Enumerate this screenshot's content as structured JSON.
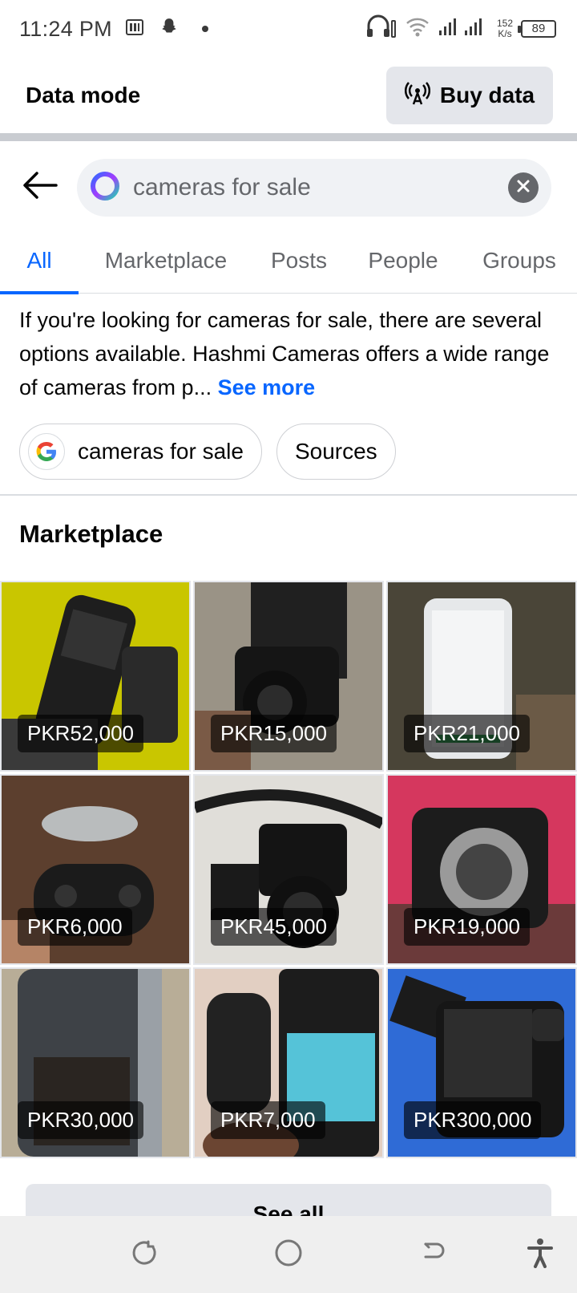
{
  "status_bar": {
    "time": "11:24 PM",
    "speed_value": "152",
    "speed_unit": "K/s",
    "battery": "89"
  },
  "data_bar": {
    "label": "Data mode",
    "buy_button": "Buy data"
  },
  "search": {
    "query": "cameras for sale"
  },
  "tabs": [
    {
      "label": "All",
      "active": true
    },
    {
      "label": "Marketplace",
      "active": false
    },
    {
      "label": "Posts",
      "active": false
    },
    {
      "label": "People",
      "active": false
    },
    {
      "label": "Groups",
      "active": false
    }
  ],
  "summary": {
    "text": "If you're looking for cameras for sale, there are several options available. Hashmi Cameras offers a wide range of cameras from p...",
    "see_more": "See more"
  },
  "chips": {
    "google": "cameras for sale",
    "sources": "Sources"
  },
  "marketplace": {
    "title": "Marketplace",
    "listings": [
      {
        "price": "PKR52,000",
        "icon": "camera-lens-icon"
      },
      {
        "price": "PKR15,000",
        "icon": "camera-icon"
      },
      {
        "price": "PKR21,000",
        "icon": "phone-icon"
      },
      {
        "price": "PKR6,000",
        "icon": "drone-icon"
      },
      {
        "price": "PKR45,000",
        "icon": "camera-icon"
      },
      {
        "price": "PKR19,000",
        "icon": "camera-body-icon"
      },
      {
        "price": "PKR30,000",
        "icon": "phone-icon"
      },
      {
        "price": "PKR7,000",
        "icon": "compact-camera-icon"
      },
      {
        "price": "PKR300,000",
        "icon": "mirrorless-camera-icon"
      }
    ],
    "see_all": "See all"
  },
  "colors": {
    "accent": "#0866ff",
    "chip_border": "#ced0d4",
    "button_bg": "#e4e6eb"
  }
}
